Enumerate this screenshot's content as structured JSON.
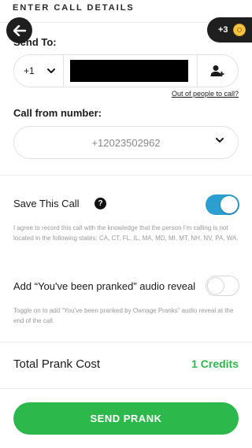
{
  "header": {
    "title": "ENTER CALL DETAILS"
  },
  "credits_pill": {
    "count": "+3",
    "icon": "coin-icon"
  },
  "send_to": {
    "label": "Send To:",
    "country_code": "+1",
    "phone_value": "",
    "contacts_icon": "add-contact-icon",
    "out_of_people_link": "Out of people to call?"
  },
  "call_from": {
    "label": "Call from number:",
    "selected": "+12023502962"
  },
  "save_call": {
    "label": "Save This Call",
    "enabled": true,
    "disclaimer": "I agree to record this call with the knowledge that the person I’m calling is not located in the following states: CA, CT, FL, IL, MA, MD, MI, MT, NH, NV, PA, WA."
  },
  "reveal": {
    "label": "Add “You've been pranked” audio reveal",
    "enabled": false,
    "description": "Toggle on to add “You’ve been pranked by Ownage Pranks” audio reveal at the end of the call."
  },
  "total": {
    "label": "Total Prank Cost",
    "value": "1 Credits"
  },
  "send_button": {
    "label": "SEND PRANK"
  },
  "colors": {
    "accent_green": "#2db84b",
    "toggle_blue": "#2a9fd0",
    "dark": "#1f1f1f"
  }
}
